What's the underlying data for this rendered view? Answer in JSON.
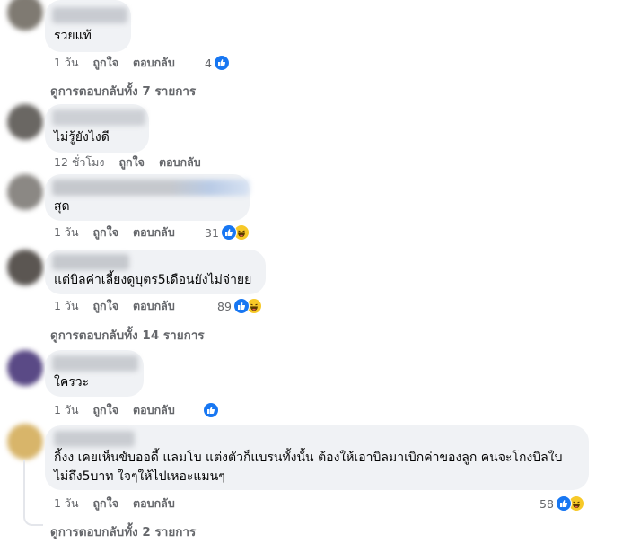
{
  "comments": [
    {
      "text": "รวยแท้",
      "time": "1 วัน",
      "like_label": "ถูกใจ",
      "reply_label": "ตอบกลับ",
      "reaction_count": "4"
    },
    {
      "text": "ไม่รู้ยังไงดี",
      "time": "12 ชั่วโมง",
      "like_label": "ถูกใจ",
      "reply_label": "ตอบกลับ"
    },
    {
      "text": "สุด",
      "time": "1 วัน",
      "like_label": "ถูกใจ",
      "reply_label": "ตอบกลับ",
      "reaction_count": "31"
    },
    {
      "text": "แต่บิลค่าเลี้ยงดูบุตร5เดือนยังไม่จ่ายย",
      "time": "1 วัน",
      "like_label": "ถูกใจ",
      "reply_label": "ตอบกลับ",
      "reaction_count": "89"
    },
    {
      "text": "ใครวะ",
      "time": "1 วัน",
      "like_label": "ถูกใจ",
      "reply_label": "ตอบกลับ"
    },
    {
      "text_line1": "กิ้งง เคยเห็นขับออดี้ แลมโบ แต่งตัวก็แบรนทั้งนั้น ต้องให้เอาบิลมาเบิกค่าของลูก คนจะโกงบิลใบ",
      "text_line2": "ไม่ถึง5บาท ใจๆให้ไปเหอะแมนๆ",
      "time": "1 วัน",
      "like_label": "ถูกใจ",
      "reply_label": "ตอบกลับ",
      "reaction_count": "58"
    }
  ],
  "view_replies": {
    "first": "ดูการตอบกลับทั้ง 7 รายการ",
    "fourth": "ดูการตอบกลับทั้ง 14 รายการ",
    "sixth": "ดูการตอบกลับทั้ง 2 รายการ"
  },
  "icons": {
    "like": "like-reaction-icon",
    "haha": "haha-reaction-icon"
  },
  "colors": {
    "bubble": "#f0f2f5",
    "meta_text": "#65676b",
    "like_blue": "#1877f2",
    "haha_yellow": "#f7c928"
  }
}
